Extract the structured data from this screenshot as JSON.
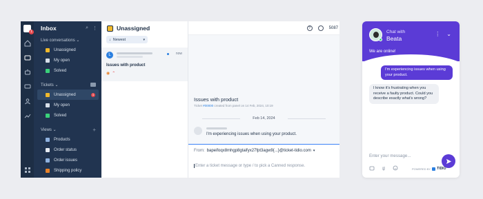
{
  "app": {
    "nav": {
      "title": "Inbox",
      "logo_badge": "1",
      "sections": {
        "live": "Live conversations",
        "tickets": "Tickets",
        "views": "Views"
      },
      "live_items": [
        {
          "label": "Unassigned",
          "color": "#f0b92c"
        },
        {
          "label": "My open",
          "color": "#d8e0ea"
        },
        {
          "label": "Solved",
          "color": "#3ad17a"
        }
      ],
      "ticket_items": [
        {
          "label": "Unassigned",
          "color": "#f0b92c",
          "count": "1"
        },
        {
          "label": "My open",
          "color": "#d8e0ea"
        },
        {
          "label": "Solved",
          "color": "#3ad17a"
        }
      ],
      "view_items": [
        {
          "label": "Products"
        },
        {
          "label": "Order status"
        },
        {
          "label": "Order issues"
        },
        {
          "label": "Shipping policy"
        }
      ]
    },
    "list": {
      "title": "Unassigned",
      "sort_label": "Newest",
      "conversation": {
        "avatar_letter": "L",
        "time": "now",
        "subject": "Issues with product"
      }
    },
    "detail": {
      "top_right_text": "5087",
      "ticket_subject": "Issues with product",
      "ticket_meta_prefix": "Ticket ",
      "ticket_meta_link": "#00000",
      "ticket_meta_suffix": " created from panel on 14 Feb, 2024, 10:19",
      "date_separator": "Feb 14, 2024",
      "message_text": "I'm experiencing issues when using your product.",
      "reply": {
        "from_label": "From:",
        "from_address": "bapeifoqx8mhgp8gtaifyx27fpt3agw9{...}@ticket-tidio.com",
        "placeholder": "Enter a ticket message or type / to pick a Canned response."
      }
    }
  },
  "widget": {
    "chat_with": "Chat with",
    "agent_name": "Beata",
    "online_text": "We are online!",
    "outgoing_message": "I'm experiencing issues when using your product.",
    "incoming_message": "I know it's frustrating when you receive a faulty product. Could you describe exactly what's wrong?",
    "input_placeholder": "Enter your message...",
    "powered_by": "POWERED BY",
    "brand": "TIDIO",
    "accent_color": "#5b3bd6"
  }
}
